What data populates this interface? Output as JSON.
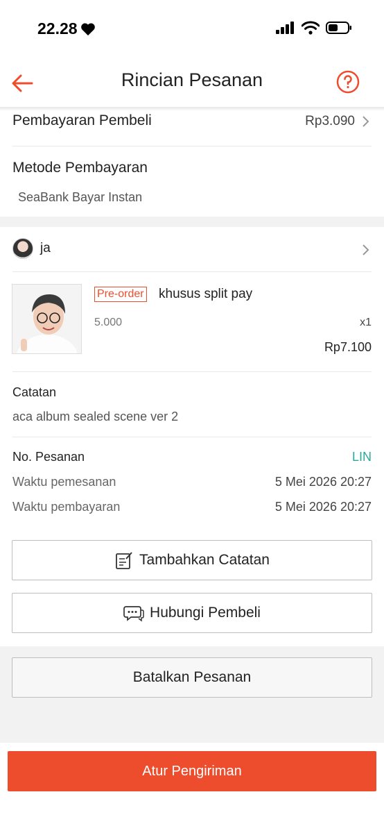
{
  "status_bar": {
    "time": "22.28"
  },
  "header": {
    "title": "Rincian Pesanan"
  },
  "payment": {
    "buyer_payment_label": "Pembayaran Pembeli",
    "buyer_payment_value": "Rp3.090",
    "method_label": "Metode Pembayaran",
    "method_value": "SeaBank Bayar Instan"
  },
  "buyer": {
    "name": "ja"
  },
  "product": {
    "badge": "Pre-order",
    "name": "khusus split pay",
    "variant": "5.000",
    "qty": "x1",
    "price": "Rp7.100"
  },
  "note": {
    "label": "Catatan",
    "value": "aca album sealed scene ver 2"
  },
  "order": {
    "number_label": "No. Pesanan",
    "number_value": "LIN",
    "order_time_label": "Waktu pemesanan",
    "order_time_value": "5 Mei 2026 20:27",
    "payment_time_label": "Waktu pembayaran",
    "payment_time_value": "5 Mei 2026 20:27"
  },
  "actions": {
    "add_note": "Tambahkan Catatan",
    "contact_buyer": "Hubungi Pembeli",
    "cancel_order": "Batalkan Pesanan",
    "arrange_shipping": "Atur Pengiriman"
  },
  "icons": {
    "back": "arrow-left-icon",
    "help": "question-circle-icon",
    "chevron": "chevron-right-icon",
    "note": "edit-note-icon",
    "chat": "chat-bubble-icon"
  },
  "colors": {
    "accent": "#ee4d2d",
    "teal": "#26aa99"
  }
}
